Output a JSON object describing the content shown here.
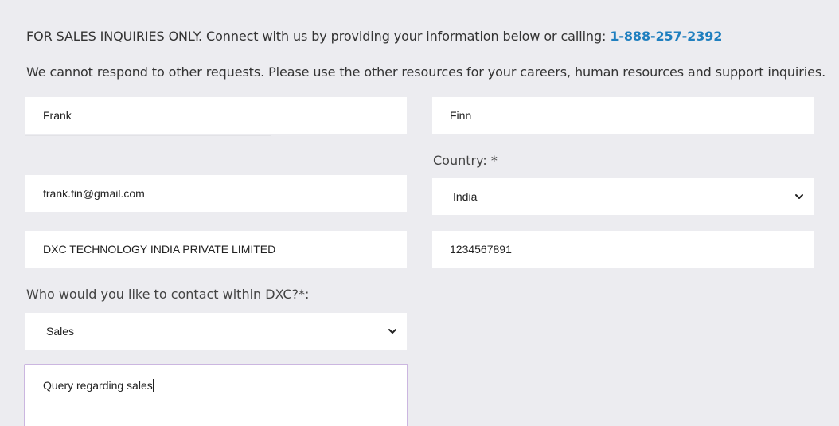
{
  "intro": {
    "line1_text": "FOR SALES INQUIRIES ONLY. Connect with us by providing your information below or calling: ",
    "phone": "1-888-257-2392",
    "line2_text": "We cannot respond to other requests. Please use the other resources for your careers, human resources and support inquiries."
  },
  "form": {
    "first_name": "Frank",
    "last_name": "Finn",
    "country_label": "Country: *",
    "country_selected": "India",
    "email": "frank.fin@gmail.com",
    "company": "DXC TECHNOLOGY INDIA PRIVATE LIMITED",
    "phone": "1234567891",
    "contact_label": "Who would you like to contact within DXC?*:",
    "contact_selected": "Sales",
    "message": "Query regarding sales"
  },
  "icons": {
    "dropdown": "chevron-down-icon"
  }
}
